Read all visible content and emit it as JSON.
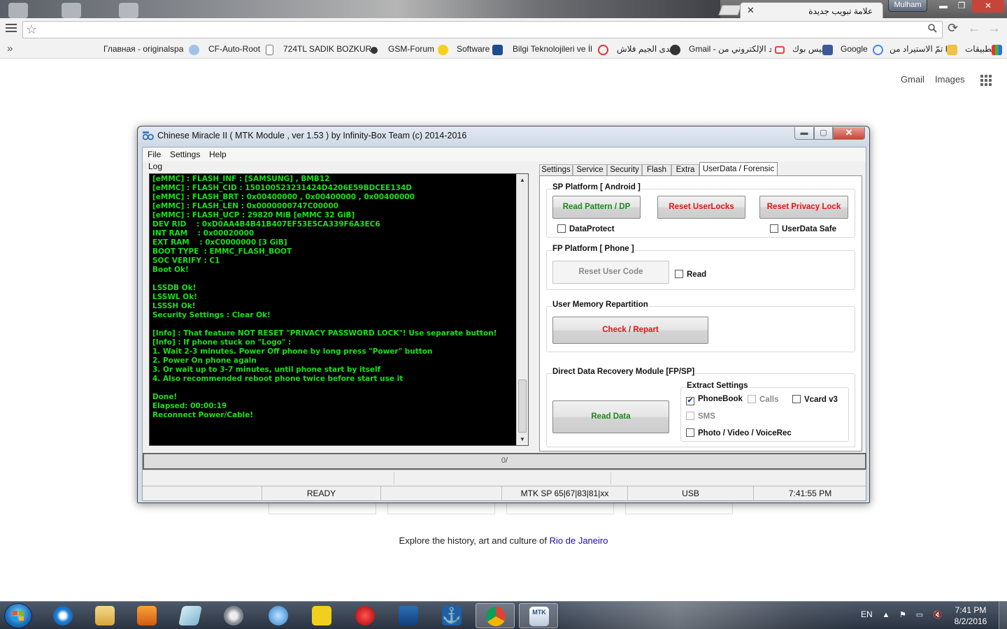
{
  "browser": {
    "tab_title": "علامة تبويب جديدة",
    "profile_name": "Mulham",
    "address_value": "",
    "bookmarks": [
      "Главная - originalspa",
      "CF-Auto-Root",
      "724TL SADIK BOZKUR",
      "GSM-Forum",
      "Software",
      "Bilgi Teknolojileri ve İl",
      "منتدى الجيم فلاش",
      "Gmail - بريد الإلكتروني من",
      "فيس بوك",
      "Google",
      "تمّ الاستيراد من IE",
      "تطبيقات"
    ],
    "overflow_chevron": "»"
  },
  "google": {
    "gmail_link": "Gmail",
    "images_link": "Images",
    "footer_text": "Explore the history, art and culture of",
    "footer_link": "Rio de Janeiro"
  },
  "app": {
    "title": "Chinese Miracle II ( MTK Module , ver 1.53 ) by Infinity-Box Team (c) 2014-2016",
    "menu": [
      "File",
      "Settings",
      "Help"
    ],
    "log_label": "Log",
    "log_lines": [
      "[eMMC] : FLASH_INF : [SAMSUNG] , BMB12",
      "[eMMC] : FLASH_CID : 150100523231424D4206E59BDCEE134D",
      "[eMMC] : FLASH_BRT : 0x00400000 , 0x00400000 , 0x00400000",
      "[eMMC] : FLASH_LEN : 0x0000000747C00000",
      "[eMMC] : FLASH_UCP : 29820 MiB [eMMC 32 GiB]",
      "DEV RID    : 0xD0AA4B4B41B407EF53E5CA339F6A3EC6",
      "INT RAM    : 0x00020000",
      "EXT RAM    : 0xC0000000 [3 GiB]",
      "BOOT TYPE  : EMMC_FLASH_BOOT",
      "SOC VERIFY : C1",
      "Boot Ok!",
      "",
      "LSSDB Ok!",
      "LSSWL Ok!",
      "LSSSH Ok!",
      "Security Settings : Clear Ok!",
      "",
      "[Info] : That feature NOT RESET \"PRIVACY PASSWORD LOCK\"! Use separate button!",
      "[Info] : If phone stuck on \"Logo\" :",
      "1. Wait 2-3 minutes. Power Off phone by long press \"Power\" button",
      "2. Power On phone again",
      "3. Or wait up to 3-7 minutes, until phone start by itself",
      "4. Also recommended reboot phone twice before start use it",
      "",
      "Done!",
      "Elapsed: 00:00:19",
      "Reconnect Power/Cable!"
    ],
    "tabs": [
      "Settings",
      "Service",
      "Security",
      "Flash",
      "Extra",
      "UserData / Forensic"
    ],
    "sp_group": {
      "title": "SP Platform [ Android ]",
      "read_pattern": "Read Pattern / DP",
      "reset_userlocks": "Reset UserLocks",
      "reset_privacy": "Reset Privacy Lock",
      "dataprotect": "DataProtect",
      "userdata_safe": "UserData Safe"
    },
    "fp_group": {
      "title": "FP Platform [ Phone ]",
      "reset_user_code": "Reset User Code",
      "read": "Read"
    },
    "umr_group": {
      "title": "User Memory Repartition",
      "check_repart": "Check / Repart"
    },
    "ddr_group": {
      "title": "Direct Data Recovery Module  [FP/SP]",
      "read_data": "Read Data",
      "extract_title": "Extract Settings",
      "phonebook": "PhoneBook",
      "calls": "Calls",
      "vcard": "Vcard v3",
      "sms": "SMS",
      "photo": "Photo / Video / VoiceRec"
    },
    "progress_text": "0/",
    "progress_fraction": 0,
    "status": {
      "state": "READY",
      "chip": "MTK SP 65|67|83|81|xx",
      "port": "USB",
      "time": "7:41:55 PM"
    },
    "colors": {
      "log_text": "#19e019",
      "button_green": "#1a8a1a",
      "button_red": "#e01414"
    }
  },
  "taskbar": {
    "language": "EN",
    "time": "7:41 PM",
    "date": "8/2/2016",
    "items": [
      "start-orb",
      "internet-explorer",
      "file-explorer",
      "media-player",
      "notepad",
      "settings-shield",
      "bluetooth-tool",
      "spt-box",
      "miracle-box",
      "anchor-tool",
      "anchor-app",
      "chrome",
      "mtk-chinese-miracle"
    ]
  }
}
